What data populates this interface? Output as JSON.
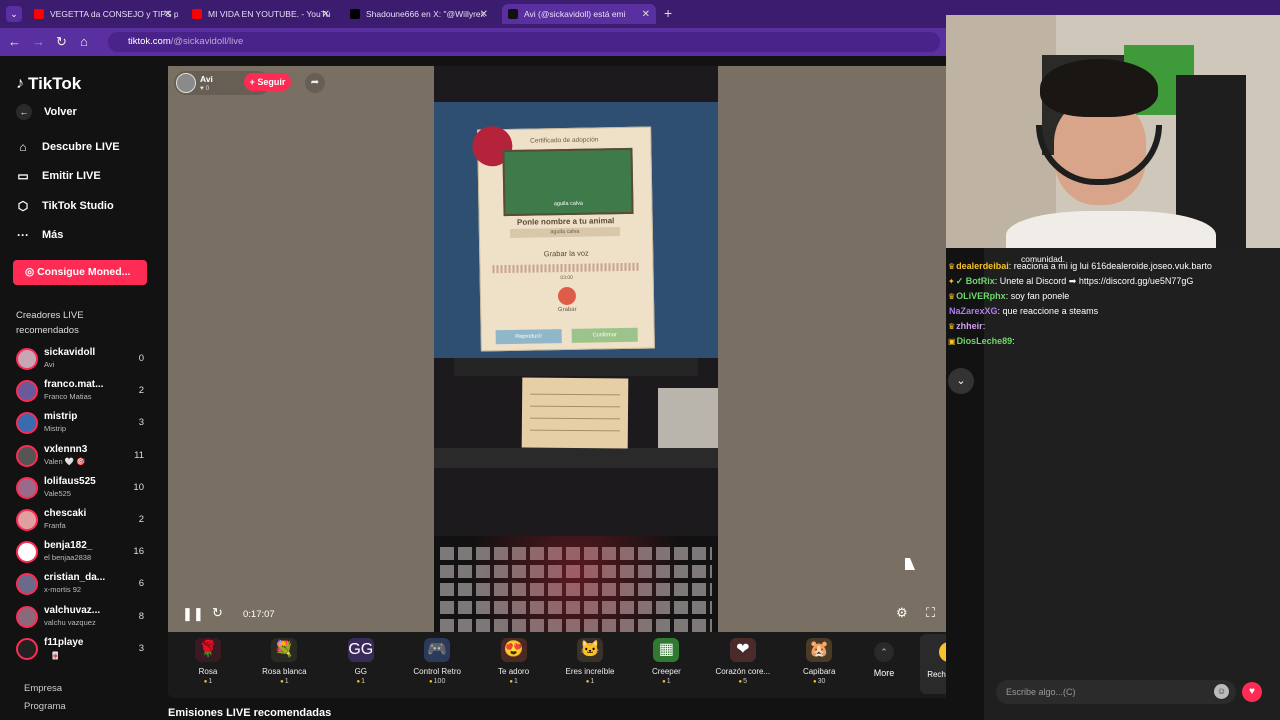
{
  "browser": {
    "tabs": [
      {
        "label": "VEGETTA da CONSEJO y TIPS p",
        "fav_color": "#ff0000"
      },
      {
        "label": "MI VIDA EN YOUTUBE. - YouTu",
        "fav_color": "#ff0000"
      },
      {
        "label": "Shadoune666 en X: \"@Willyrex",
        "fav_color": "#000000"
      },
      {
        "label": "Avi (@sickavidoll) está emi",
        "fav_color": "#111111"
      }
    ],
    "new_tab": "+",
    "url_domain": "tiktok.com",
    "url_path": "/@sickavidoll/live"
  },
  "sidebar": {
    "logo": "TikTok",
    "back": "Volver",
    "nav": [
      {
        "label": "Descubre LIVE",
        "icon": "home-icon"
      },
      {
        "label": "Emitir LIVE",
        "icon": "video-camera-icon"
      },
      {
        "label": "TikTok Studio",
        "icon": "studio-icon"
      },
      {
        "label": "Más",
        "icon": "more-dots-icon"
      }
    ],
    "coins_button": "Consigue Moned...",
    "creators_title": "Creadores LIVE recomendados",
    "creators": [
      {
        "name": "sickavidoll",
        "sub": "Avi",
        "count": "0",
        "color": "#c7a6b5"
      },
      {
        "name": "franco.mat...",
        "sub": "Franco Matias",
        "count": "2",
        "color": "#6a5a9a"
      },
      {
        "name": "mistrip",
        "sub": "Mistrip",
        "count": "3",
        "color": "#3a6ab0"
      },
      {
        "name": "vxlennn3",
        "sub": "Valen 🤍 🎯",
        "count": "11",
        "color": "#555555"
      },
      {
        "name": "lolifaus525",
        "sub": "Vale525",
        "count": "10",
        "color": "#9a6a8a"
      },
      {
        "name": "chescaki",
        "sub": "Franfa",
        "count": "2",
        "color": "#e0a0a0"
      },
      {
        "name": "benja182_",
        "sub": "el benjaa2838",
        "count": "16",
        "color": "#ffffff"
      },
      {
        "name": "cristian_da...",
        "sub": "x-mortis 92",
        "count": "6",
        "color": "#6a6a8a"
      },
      {
        "name": "valchuvaz...",
        "sub": "valchu vazquez",
        "count": "8",
        "color": "#8a6a7a"
      },
      {
        "name": "f11playe",
        "sub": "ㅤ🀄",
        "count": "3",
        "color": "#222222"
      }
    ],
    "footer": [
      "Empresa",
      "Programa"
    ]
  },
  "stream": {
    "host_name": "Avi",
    "host_likes": "♥ 0",
    "follow": "+ Seguir",
    "elapsed": "0:17:07",
    "certificate": {
      "title": "Certificado de adopción",
      "picture_label": "aguila calva",
      "prompt": "Ponle nombre a tu animal",
      "input_value": "aguila calva",
      "voice": "Grabar la voz",
      "time": "03:00",
      "record": "Grabar",
      "btn_replay": "Reproducir",
      "btn_confirm": "Confirmar"
    }
  },
  "gifts": [
    {
      "name": "Rosa",
      "price": "1",
      "icon": "🌹",
      "bg": "#3a1a22"
    },
    {
      "name": "Rosa blanca",
      "price": "1",
      "icon": "💐",
      "bg": "#2a2a22"
    },
    {
      "name": "GG",
      "price": "1",
      "icon": "GG",
      "bg": "#3a2a5a"
    },
    {
      "name": "Control Retro",
      "price": "100",
      "icon": "🎮",
      "bg": "#2a3a5a"
    },
    {
      "name": "Te adoro",
      "price": "1",
      "icon": "😍",
      "bg": "#4a2a22"
    },
    {
      "name": "Eres increíble",
      "price": "1",
      "icon": "🐱",
      "bg": "#3a3228"
    },
    {
      "name": "Creeper",
      "price": "1",
      "icon": "▦",
      "bg": "#2f7a30"
    },
    {
      "name": "Corazón core...",
      "price": "5",
      "icon": "❤",
      "bg": "#4a2a2a"
    },
    {
      "name": "Capibara",
      "price": "30",
      "icon": "🐹",
      "bg": "#4a3a28"
    }
  ],
  "more_label": "More",
  "recharge_label": "Recharge",
  "section_title": "Emisiones LIVE recomendadas",
  "chat": {
    "tooltip": "comunidad.",
    "lines": [
      {
        "user": "dealerdeibai",
        "color": "#f7c22b",
        "badge": "♛",
        "text": ": reaciona a mi ig lui 616dealeroide.joseo.vuk.barto"
      },
      {
        "user": "✓ BotRix",
        "color": "#6fd86b",
        "badge": "✦",
        "text": ": Unete al Discord ➡ https://discord.gg/ue5N77gG"
      },
      {
        "user": "OLiVERphx",
        "color": "#6fd86b",
        "badge": "♛",
        "text": ": soy fan ponele"
      },
      {
        "user": "NaZarexXG",
        "color": "#b07cf0",
        "badge": "",
        "text": ": que reaccione a steams"
      },
      {
        "user": "zhheir",
        "color": "#cfa0f0",
        "badge": "♛",
        "text": ":"
      },
      {
        "user": "DiosLeche89",
        "color": "#6fd86b",
        "badge": "▣",
        "text": ":"
      }
    ],
    "input_placeholder": "Escribe algo...(C)"
  },
  "colors": {
    "accent": "#fe2c55",
    "browser": "#5a2fa0",
    "coin": "#f7c22b"
  }
}
